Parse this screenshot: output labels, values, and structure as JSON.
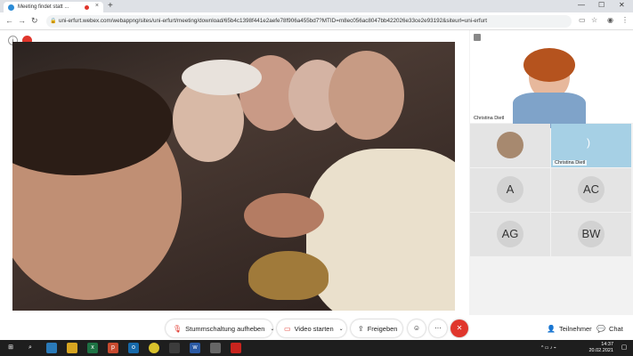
{
  "browser": {
    "tab_title": "Meeting findet statt ...",
    "new_tab": "+",
    "tab_close": "×",
    "url": "uni-erfurt.webex.com/webappng/sites/uni-erfurt/meeting/download/65b4c1398f441e2aefe78f906a455bd7?MTID=m8ec056ac8047bb422026e33ce2e93192&siteurl=uni-erfurt",
    "nav_back": "←",
    "nav_forward": "→",
    "nav_reload": "↻",
    "win_min": "—",
    "win_max": "☐",
    "win_close": "✕"
  },
  "participants": {
    "self_name": "Christina Dietl",
    "tiles": [
      {
        "name": "",
        "initials": ""
      },
      {
        "name": "Christina Dietl",
        "initials": ""
      },
      {
        "name": "",
        "initials": "A"
      },
      {
        "name": "",
        "initials": "AC"
      },
      {
        "name": "",
        "initials": "AG"
      },
      {
        "name": "",
        "initials": "BW"
      }
    ]
  },
  "toolbar": {
    "mute_label": "Stummschaltung aufheben",
    "video_label": "Video starten",
    "share_label": "Freigeben",
    "more_label": "···",
    "end_label": "✕",
    "participants_label": "Teilnehmer",
    "chat_label": "Chat"
  },
  "taskbar": {
    "time": "14:37",
    "date": "20.02.2021"
  },
  "colors": {
    "end_button": "#e0362c",
    "accent": "#2c8cd6"
  }
}
